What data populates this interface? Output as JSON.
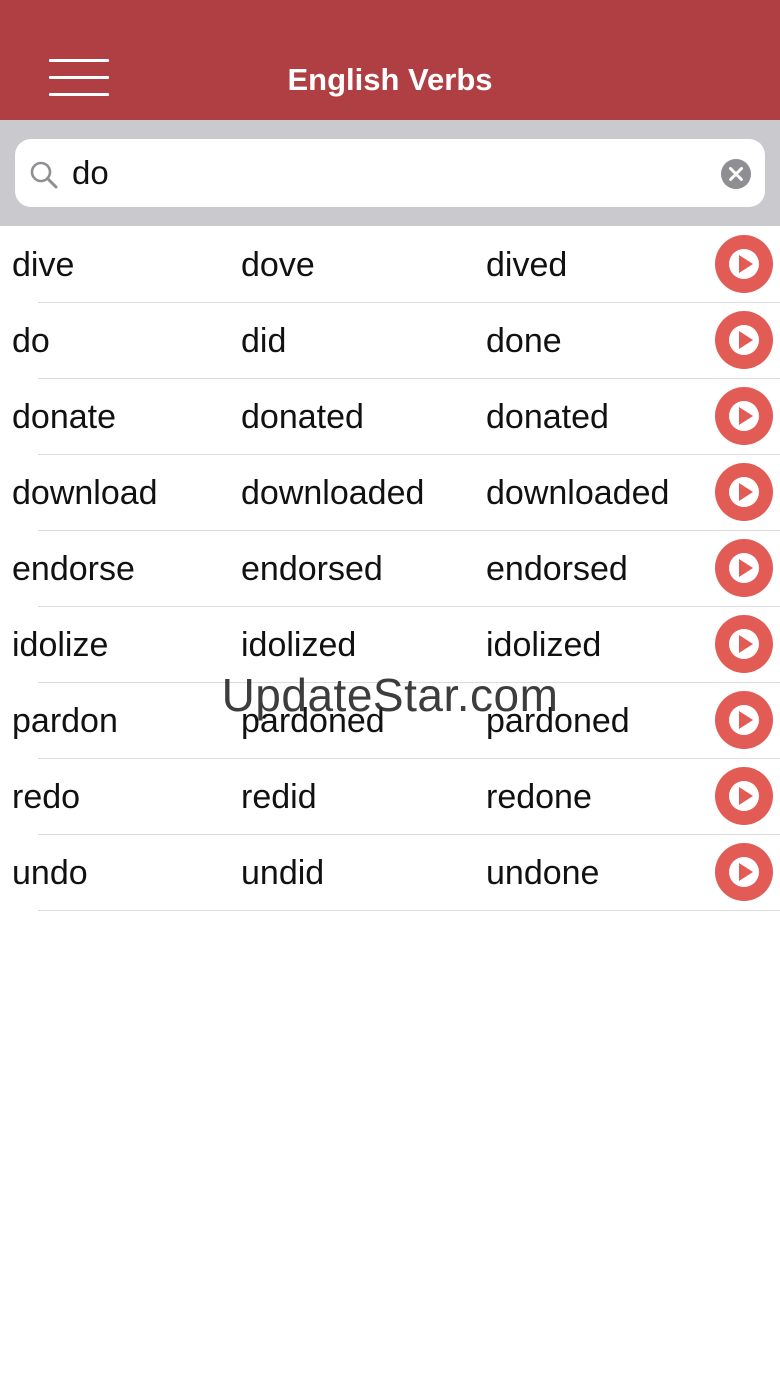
{
  "header": {
    "title": "English Verbs",
    "menu_icon": "hamburger-icon",
    "background_color": "#b03f43"
  },
  "search": {
    "value": "do",
    "icon": "search-icon",
    "clear_icon": "clear-icon"
  },
  "verbs": [
    {
      "base": "dive",
      "past": "dove",
      "participle": "dived"
    },
    {
      "base": "do",
      "past": "did",
      "participle": "done"
    },
    {
      "base": "donate",
      "past": "donated",
      "participle": "donated"
    },
    {
      "base": "download",
      "past": "downloaded",
      "participle": "downloaded"
    },
    {
      "base": "endorse",
      "past": "endorsed",
      "participle": "endorsed"
    },
    {
      "base": "idolize",
      "past": "idolized",
      "participle": "idolized"
    },
    {
      "base": "pardon",
      "past": "pardoned",
      "participle": "pardoned"
    },
    {
      "base": "redo",
      "past": "redid",
      "participle": "redone"
    },
    {
      "base": "undo",
      "past": "undid",
      "participle": "undone"
    }
  ],
  "play_icon": "play-icon",
  "play_color": "#e35b55",
  "watermark": "UpdateStar.com"
}
